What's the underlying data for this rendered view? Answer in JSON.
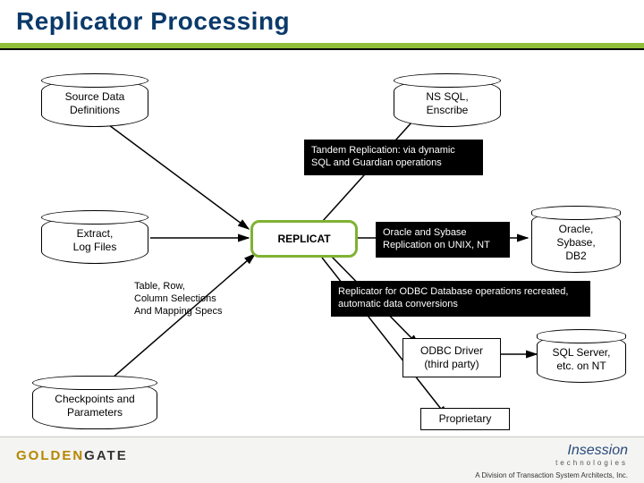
{
  "title": "Replicator Processing",
  "nodes": {
    "source_data": "Source Data\nDefinitions",
    "ns_sql": "NS SQL,\nEnscribe",
    "extract": "Extract,\nLog Files",
    "replicat": "REPLICAT",
    "oracle_sybase_db2": "Oracle,\nSybase,\nDB2",
    "checkpoints": "Checkpoints and\nParameters",
    "odbc_driver": "ODBC Driver\n(third party)",
    "sqlserver": "SQL Server,\netc. on NT",
    "proprietary": "Proprietary"
  },
  "labels": {
    "tandem": "Tandem Replication: via dynamic SQL and Guardian operations",
    "oracle_sybase_unix": "Oracle and Sybase Replication on UNIX, NT",
    "odbc_recreated": "Replicator for ODBC Database operations recreated, automatic data conversions",
    "table_row": "Table, Row,\nColumn Selections\nAnd Mapping Specs"
  },
  "footer": {
    "logo1a": "GOLDEN",
    "logo1b": "GATE",
    "logo2": "Insession",
    "logo2sub": "technologies",
    "division": "A Division of Transaction System Architects, Inc."
  }
}
